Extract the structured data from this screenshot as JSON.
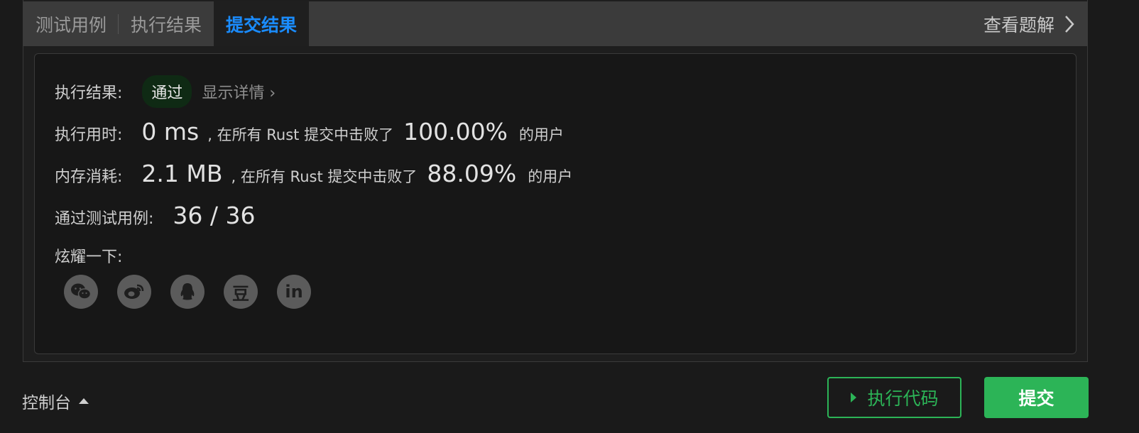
{
  "tabs": [
    {
      "label": "测试用例"
    },
    {
      "label": "执行结果"
    },
    {
      "label": "提交结果"
    }
  ],
  "view_solution": {
    "label": "查看题解",
    "icon": "chevron-right-icon"
  },
  "result": {
    "status_label": "执行结果:",
    "status_value": "通过",
    "details_link": "显示详情 ›"
  },
  "runtime": {
    "label": "执行用时:",
    "value": "0 ms",
    "mid": ", 在所有 Rust 提交中击败了",
    "percent": "100.00%",
    "suffix": "的用户"
  },
  "memory": {
    "label": "内存消耗:",
    "value": "2.1 MB",
    "mid": ", 在所有 Rust 提交中击败了",
    "percent": "88.09%",
    "suffix": "的用户"
  },
  "tests": {
    "label": "通过测试用例:",
    "value": "36 / 36"
  },
  "share": {
    "label": "炫耀一下:",
    "items": [
      {
        "icon": "wechat-icon"
      },
      {
        "icon": "weibo-icon"
      },
      {
        "icon": "qq-icon"
      },
      {
        "icon": "douban-icon",
        "glyph": "豆"
      },
      {
        "icon": "linkedin-icon",
        "glyph": "in"
      }
    ]
  },
  "footer": {
    "console_label": "控制台",
    "run_label": "执行代码",
    "submit_label": "提交"
  },
  "colors": {
    "accent_blue": "#1a8cff",
    "success_green": "#2cb457"
  }
}
